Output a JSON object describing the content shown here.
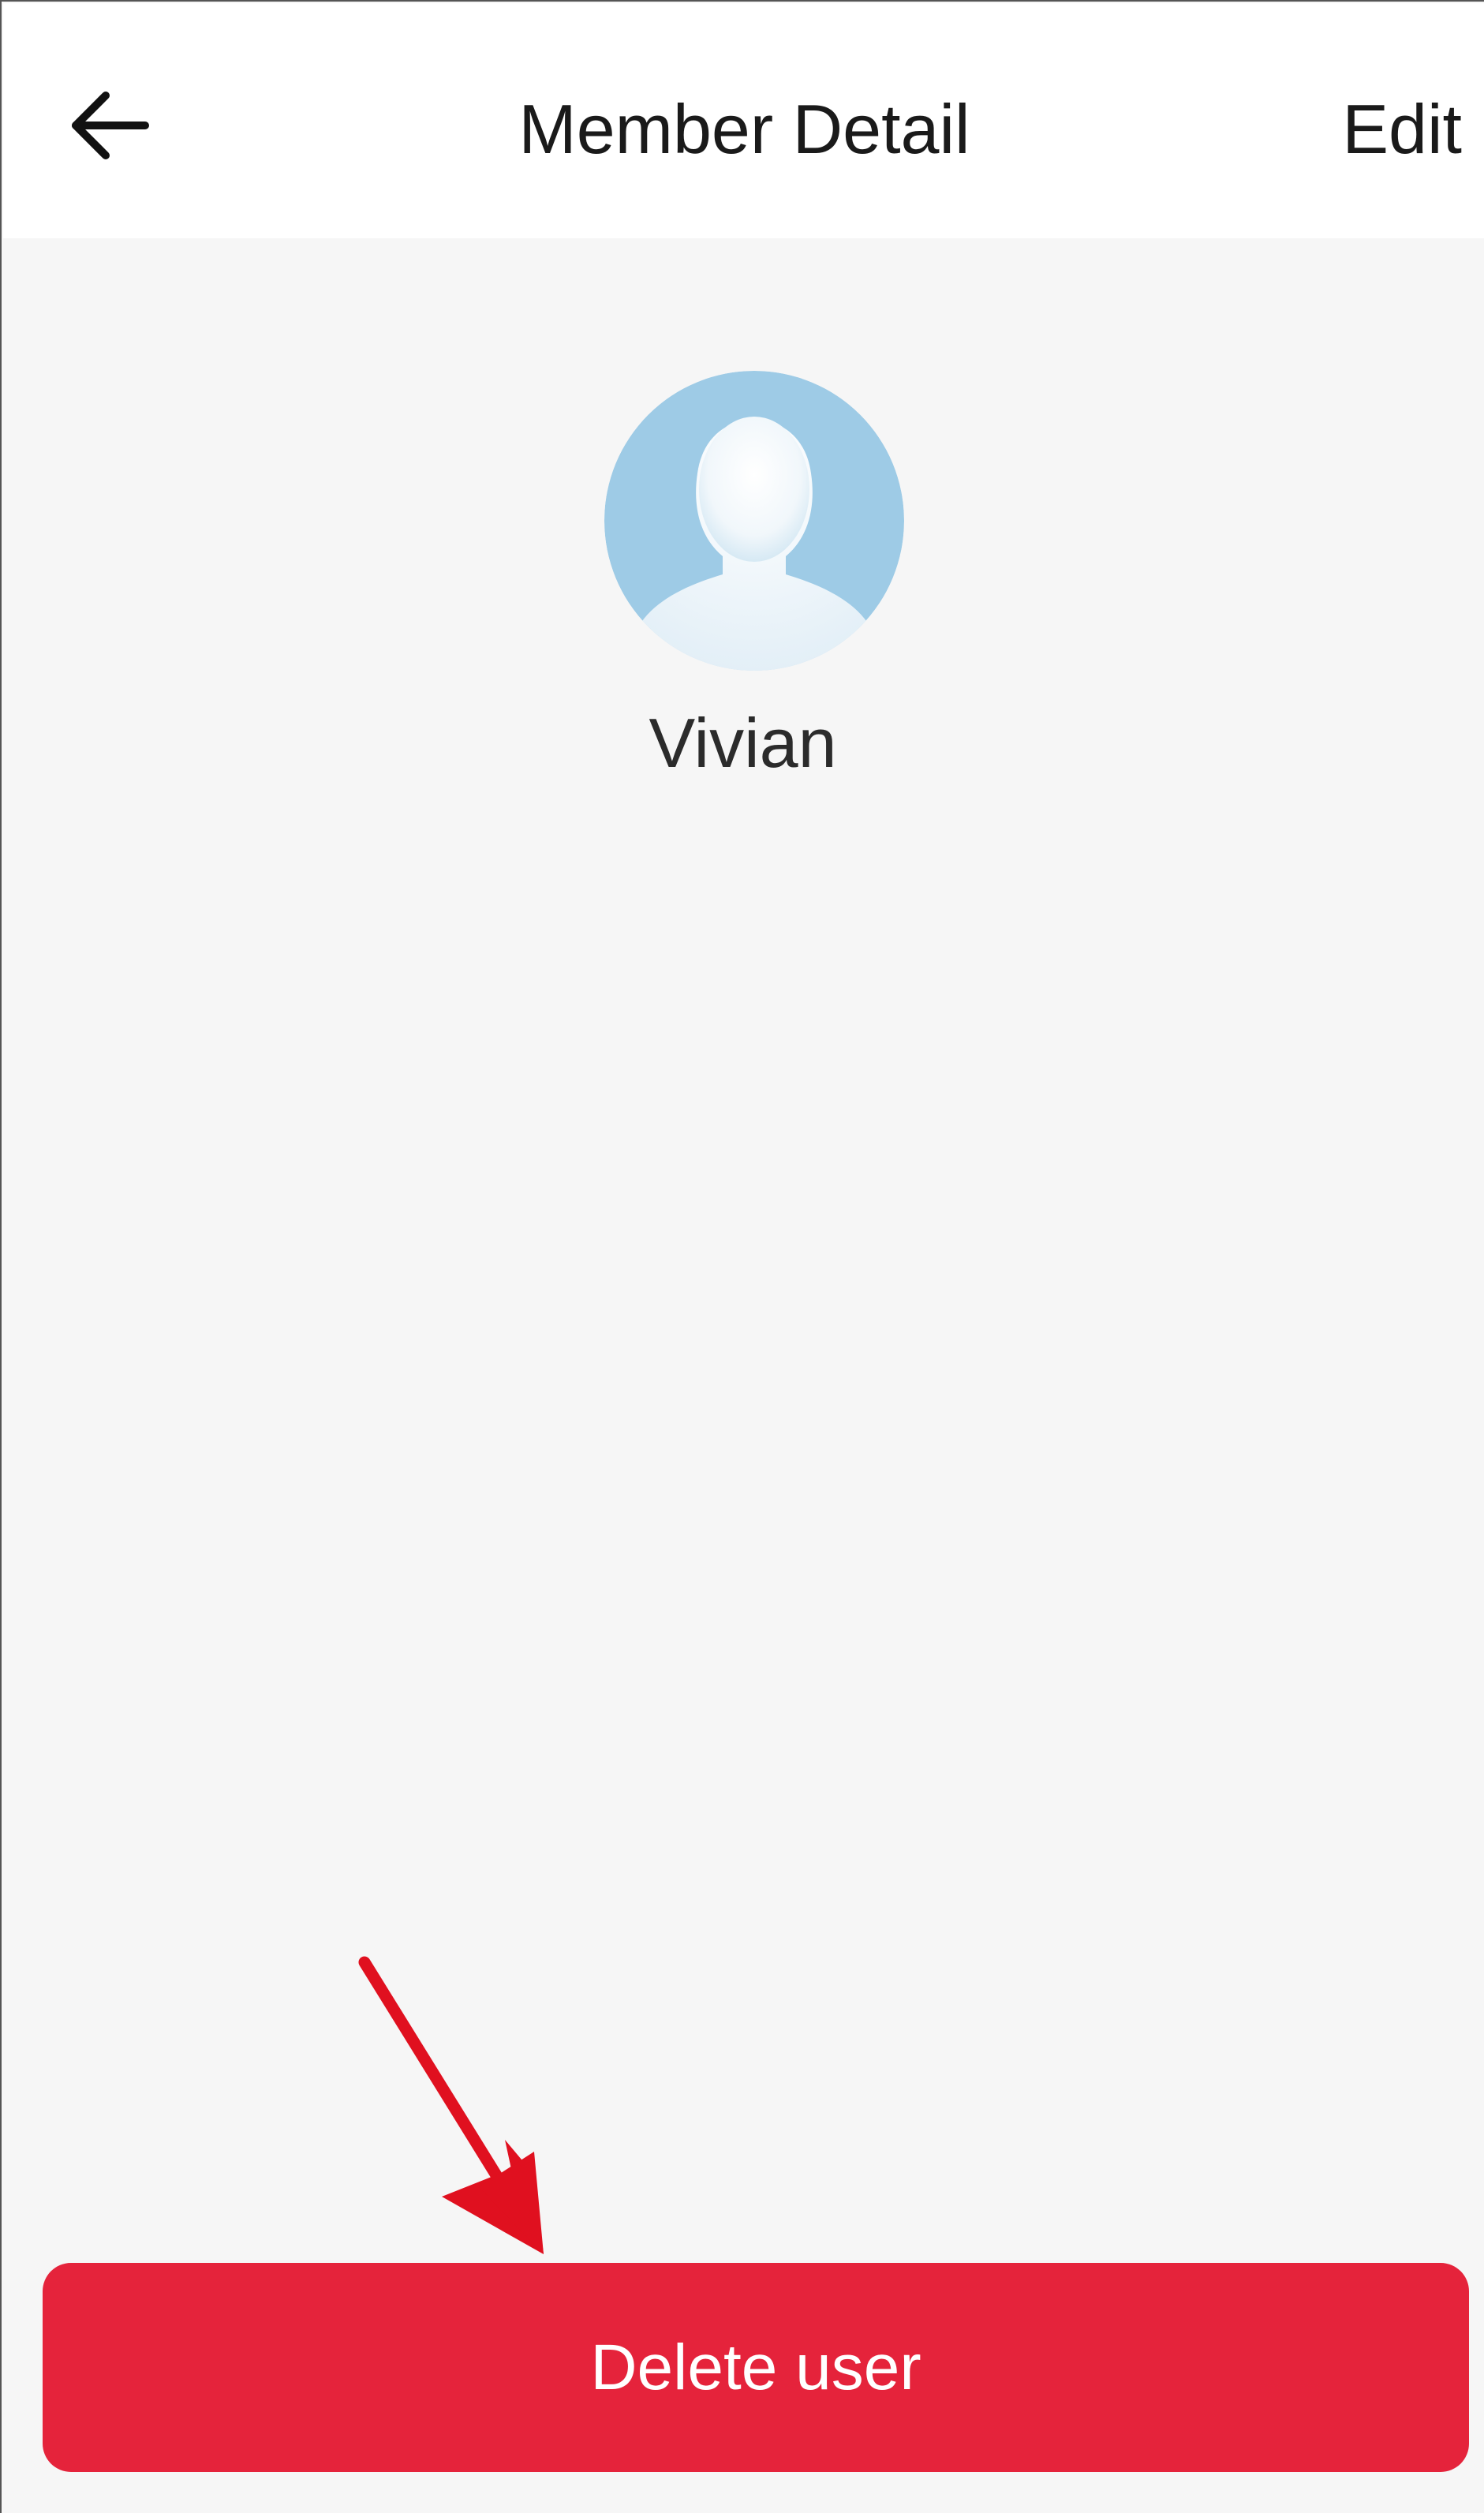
{
  "header": {
    "back_icon": "arrow-left-icon",
    "title": "Member Detail",
    "edit_label": "Edit"
  },
  "member": {
    "avatar_icon": "user-avatar-placeholder",
    "name": "Vivian"
  },
  "actions": {
    "delete_label": "Delete user"
  },
  "colors": {
    "danger": "#e5233b",
    "avatar_bg": "#9ecbe6",
    "page_bg": "#f6f6f6",
    "annotation": "#e0101f"
  }
}
